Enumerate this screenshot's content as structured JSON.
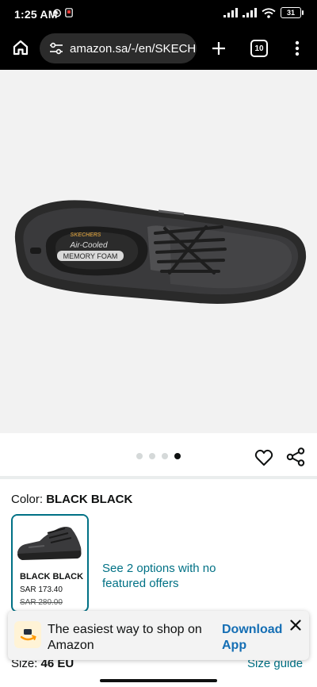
{
  "status_bar": {
    "time": "1:25 AM",
    "battery": "31"
  },
  "browser": {
    "url": "amazon.sa/-/en/SKECHE",
    "tab_count": "10",
    "icons": [
      "home-icon",
      "tune-icon",
      "plus-icon",
      "tabs-icon",
      "more-vert-icon"
    ]
  },
  "product": {
    "image_alt": "Black Skechers Air-Cooled Memory Foam shoe",
    "carousel": {
      "dot_count": 4,
      "active_index": 3
    }
  },
  "color": {
    "label": "Color:",
    "value": "BLACK BLACK"
  },
  "swatch": {
    "name": "BLACK BLACK",
    "price": "SAR 173.40",
    "list_price": "SAR 280.00"
  },
  "see_options": "See 2 options with no featured offers",
  "size": {
    "label": "Size:",
    "value": "46 EU",
    "guide": "Size guide"
  },
  "banner": {
    "text": "The easiest way to shop on Amazon",
    "action": "Download App"
  },
  "colors": {
    "link": "#007185",
    "banner_link": "#146eb4",
    "accent": "#ff9900"
  }
}
